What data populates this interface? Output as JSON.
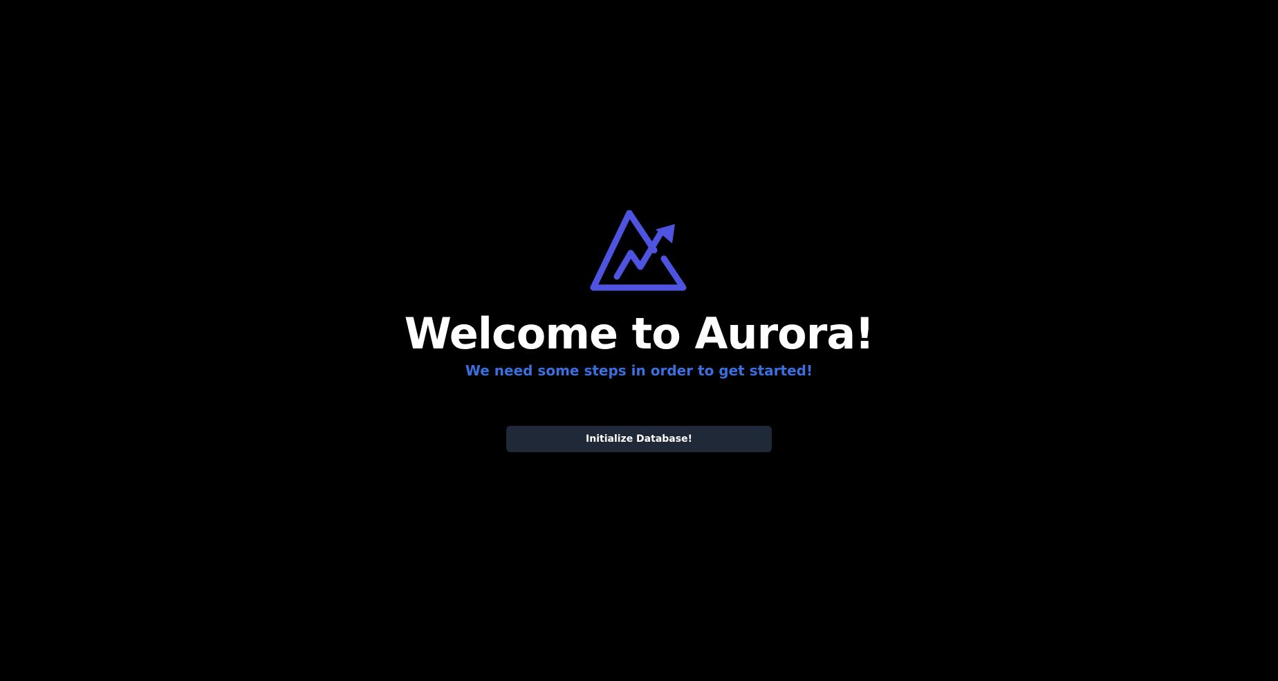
{
  "logo": {
    "icon": "mountain-arrow-logo-icon",
    "color": "#4f54e0"
  },
  "welcome": {
    "title": "Welcome to Aurora!",
    "subtitle": "We need some steps in order to get started!"
  },
  "actions": {
    "initialize_label": "Initialize Database!"
  },
  "colors": {
    "background": "#000000",
    "title": "#ffffff",
    "subtitle": "#3b6fe0",
    "button_bg": "#1f2937",
    "button_text": "#ffffff"
  }
}
